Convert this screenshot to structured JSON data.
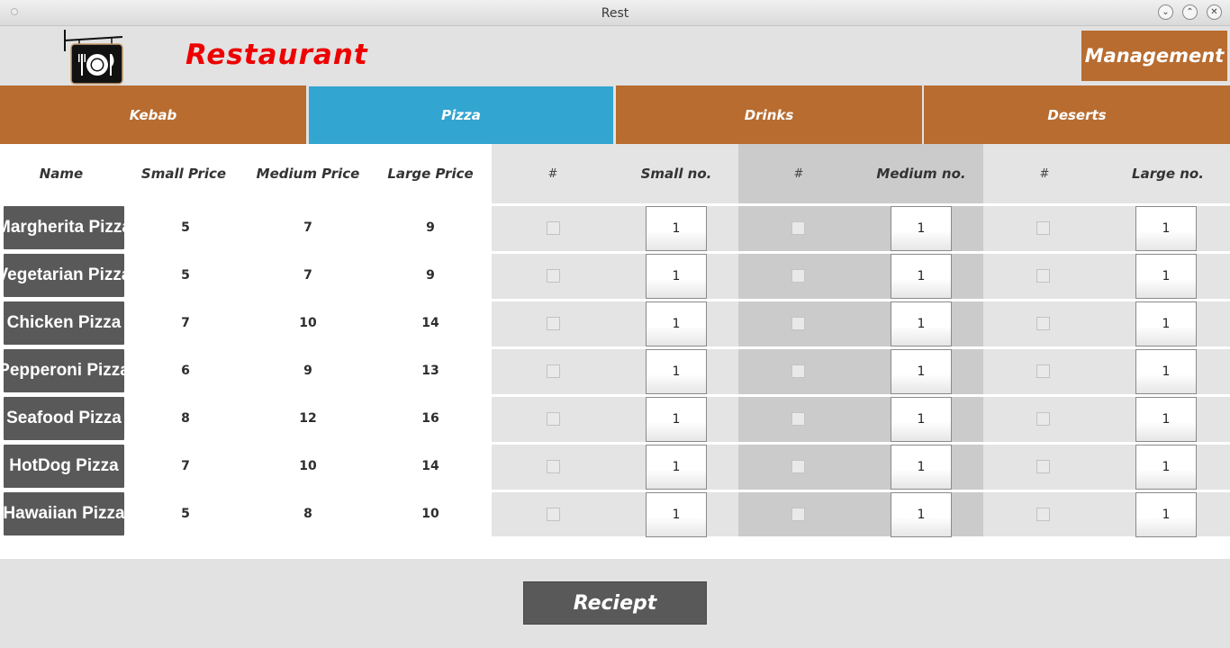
{
  "window": {
    "title": "Rest"
  },
  "header": {
    "title": "Restaurant",
    "management_label": "Management"
  },
  "tabs": [
    {
      "label": "Kebab",
      "active": false
    },
    {
      "label": "Pizza",
      "active": true
    },
    {
      "label": "Drinks",
      "active": false
    },
    {
      "label": "Deserts",
      "active": false
    }
  ],
  "table": {
    "headers": {
      "name": "Name",
      "small_price": "Small Price",
      "medium_price": "Medium Price",
      "large_price": "Large Price",
      "small_check": "#",
      "small_no": "Small no.",
      "medium_check": "#",
      "medium_no": "Medium no.",
      "large_check": "#",
      "large_no": "Large no."
    },
    "rows": [
      {
        "name": "Margherita Pizza",
        "small": "5",
        "medium": "7",
        "large": "9",
        "small_qty": "1",
        "medium_qty": "1",
        "large_qty": "1"
      },
      {
        "name": "Vegetarian Pizza",
        "small": "5",
        "medium": "7",
        "large": "9",
        "small_qty": "1",
        "medium_qty": "1",
        "large_qty": "1"
      },
      {
        "name": "Chicken Pizza",
        "small": "7",
        "medium": "10",
        "large": "14",
        "small_qty": "1",
        "medium_qty": "1",
        "large_qty": "1"
      },
      {
        "name": "Pepperoni Pizza",
        "small": "6",
        "medium": "9",
        "large": "13",
        "small_qty": "1",
        "medium_qty": "1",
        "large_qty": "1"
      },
      {
        "name": "Seafood Pizza",
        "small": "8",
        "medium": "12",
        "large": "16",
        "small_qty": "1",
        "medium_qty": "1",
        "large_qty": "1"
      },
      {
        "name": "HotDog Pizza",
        "small": "7",
        "medium": "10",
        "large": "14",
        "small_qty": "1",
        "medium_qty": "1",
        "large_qty": "1"
      },
      {
        "name": "Hawaiian Pizza",
        "small": "5",
        "medium": "8",
        "large": "10",
        "small_qty": "1",
        "medium_qty": "1",
        "large_qty": "1"
      }
    ]
  },
  "footer": {
    "receipt_label": "Reciept"
  },
  "icons": {
    "logo": "restaurant-sign-icon",
    "minimize": "minimize-icon",
    "maximize": "maximize-icon",
    "close": "close-icon"
  },
  "colors": {
    "tab_bg": "#b86c30",
    "tab_active": "#33a5d1",
    "title_red": "#ee0000",
    "name_button": "#595959"
  }
}
